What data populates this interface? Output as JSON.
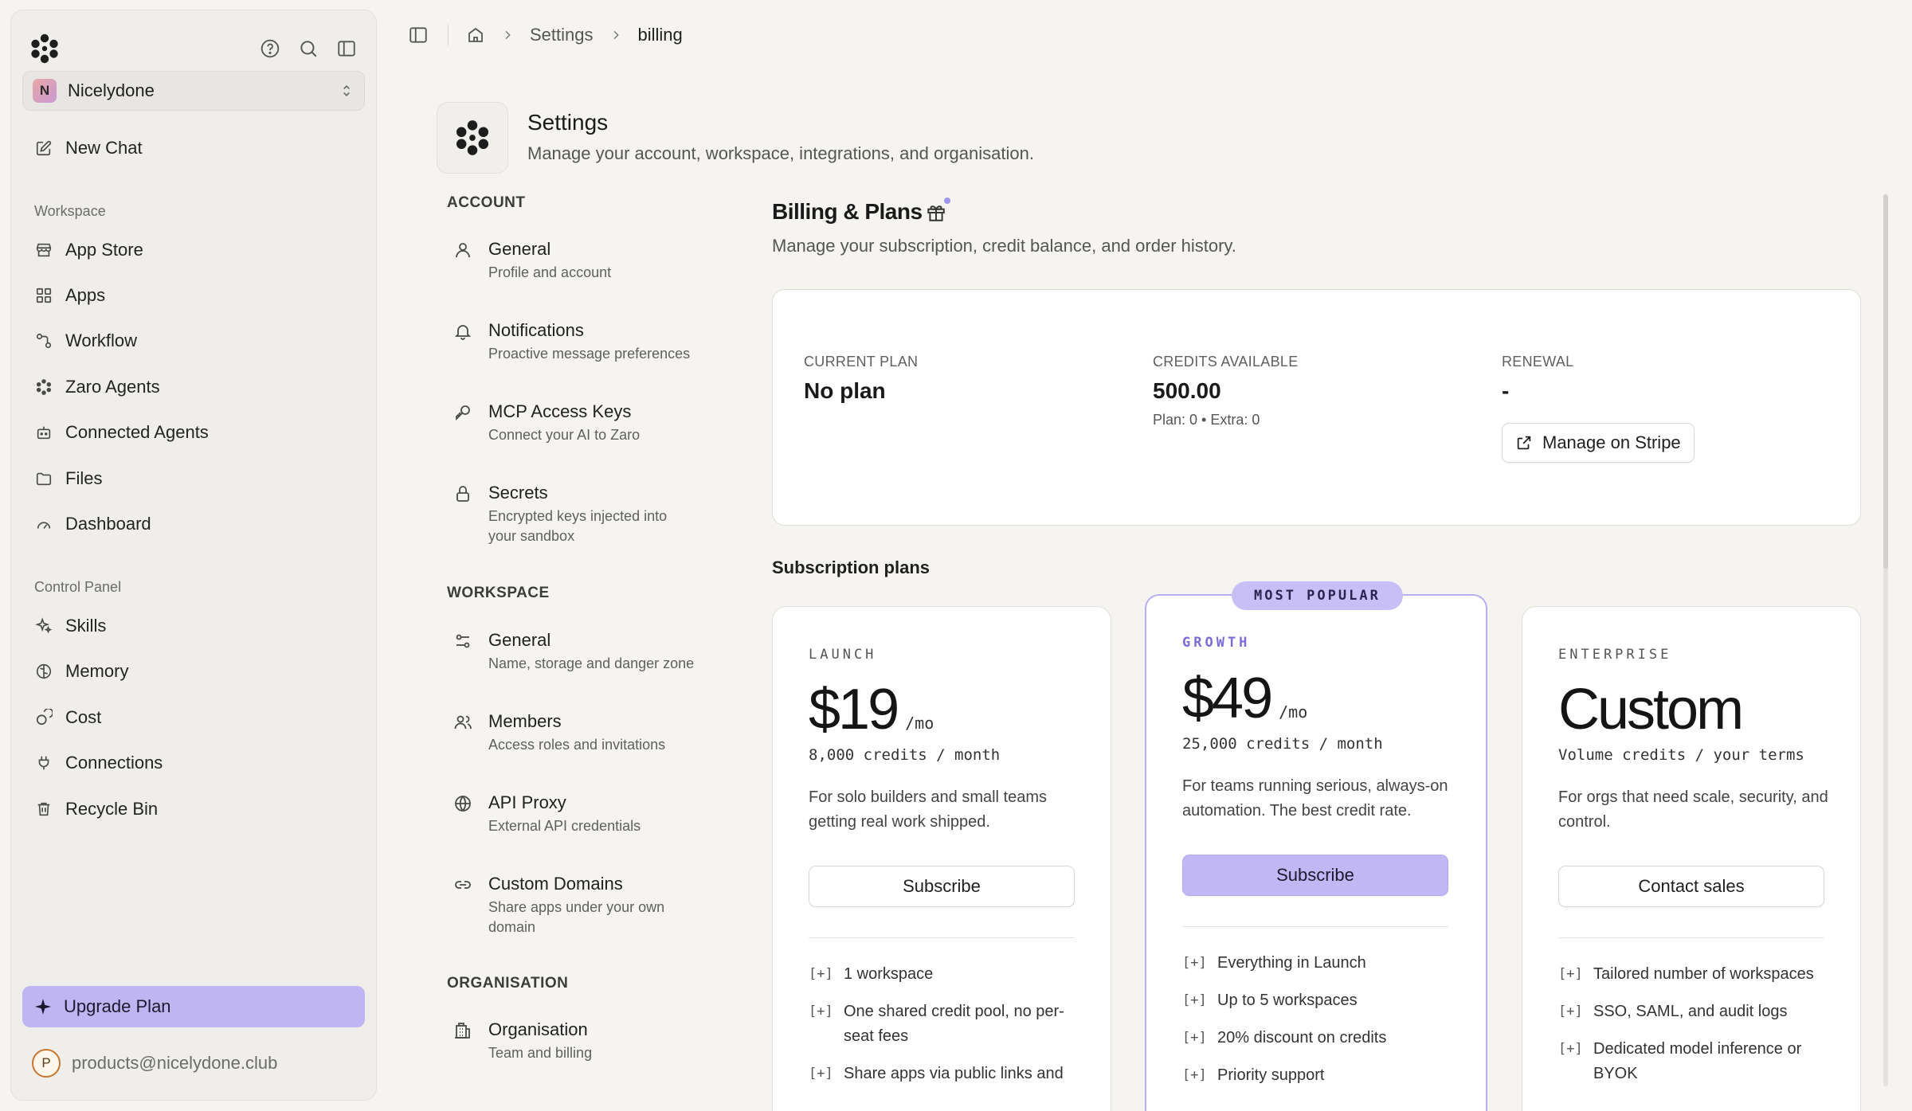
{
  "sidebar": {
    "workspace_initial": "N",
    "workspace_name": "Nicelydone",
    "new_chat": "New Chat",
    "workspace_section": "Workspace",
    "workspace_items": [
      "App Store",
      "Apps",
      "Workflow",
      "Zaro Agents",
      "Connected Agents",
      "Files",
      "Dashboard"
    ],
    "control_section": "Control Panel",
    "control_items": [
      "Skills",
      "Memory",
      "Cost",
      "Connections",
      "Recycle Bin"
    ],
    "upgrade": "Upgrade Plan",
    "account_initial": "P",
    "account_email": "products@nicelydone.club"
  },
  "breadcrumb": {
    "settings": "Settings",
    "current": "billing"
  },
  "settings": {
    "title": "Settings",
    "subtitle": "Manage your account, workspace, integrations, and organisation.",
    "account_section": "ACCOUNT",
    "account_items": [
      {
        "title": "General",
        "desc": "Profile and account"
      },
      {
        "title": "Notifications",
        "desc": "Proactive message preferences"
      },
      {
        "title": "MCP Access Keys",
        "desc": "Connect your AI to Zaro"
      },
      {
        "title": "Secrets",
        "desc": "Encrypted keys injected into your sandbox"
      }
    ],
    "workspace_section": "WORKSPACE",
    "workspace_items": [
      {
        "title": "General",
        "desc": "Name, storage and danger zone"
      },
      {
        "title": "Members",
        "desc": "Access roles and invitations"
      },
      {
        "title": "API Proxy",
        "desc": "External API credentials"
      },
      {
        "title": "Custom Domains",
        "desc": "Share apps under your own domain"
      }
    ],
    "org_section": "ORGANISATION",
    "org_items": [
      {
        "title": "Organisation",
        "desc": "Team and billing"
      }
    ]
  },
  "billing": {
    "title": "Billing & Plans",
    "subtitle": "Manage your subscription, credit balance, and order history.",
    "current_plan_label": "CURRENT PLAN",
    "current_plan_value": "No plan",
    "credits_label": "CREDITS AVAILABLE",
    "credits_value": "500.00",
    "credits_detail": "Plan: 0 • Extra: 0",
    "renewal_label": "RENEWAL",
    "renewal_value": "-",
    "manage_button": "Manage on Stripe",
    "subscription_title": "Subscription plans"
  },
  "plans": [
    {
      "name": "LAUNCH",
      "price": "$19",
      "period": "/mo",
      "credits": "8,000 credits / month",
      "desc": "For solo builders and small teams getting real work shipped.",
      "button": "Subscribe",
      "features": [
        "1 workspace",
        "One shared credit pool, no per-seat fees",
        "Share apps via public links and"
      ]
    },
    {
      "badge": "MOST POPULAR",
      "name": "GROWTH",
      "price": "$49",
      "period": "/mo",
      "credits": "25,000 credits / month",
      "desc": "For teams running serious, always-on automation. The best credit rate.",
      "button": "Subscribe",
      "features": [
        "Everything in Launch",
        "Up to 5 workspaces",
        "20% discount on credits",
        "Priority support"
      ]
    },
    {
      "name": "ENTERPRISE",
      "price": "Custom",
      "credits": "Volume credits / your terms",
      "desc": "For orgs that need scale, security, and control.",
      "button": "Contact sales",
      "features": [
        "Tailored number of workspaces",
        "SSO, SAML, and audit logs",
        "Dedicated model inference or BYOK"
      ]
    }
  ],
  "feature_marker": "[+]",
  "colors": {
    "accent": "#bfb5f2",
    "accent_text": "#7a6cd6",
    "background": "#f5f4f1"
  }
}
